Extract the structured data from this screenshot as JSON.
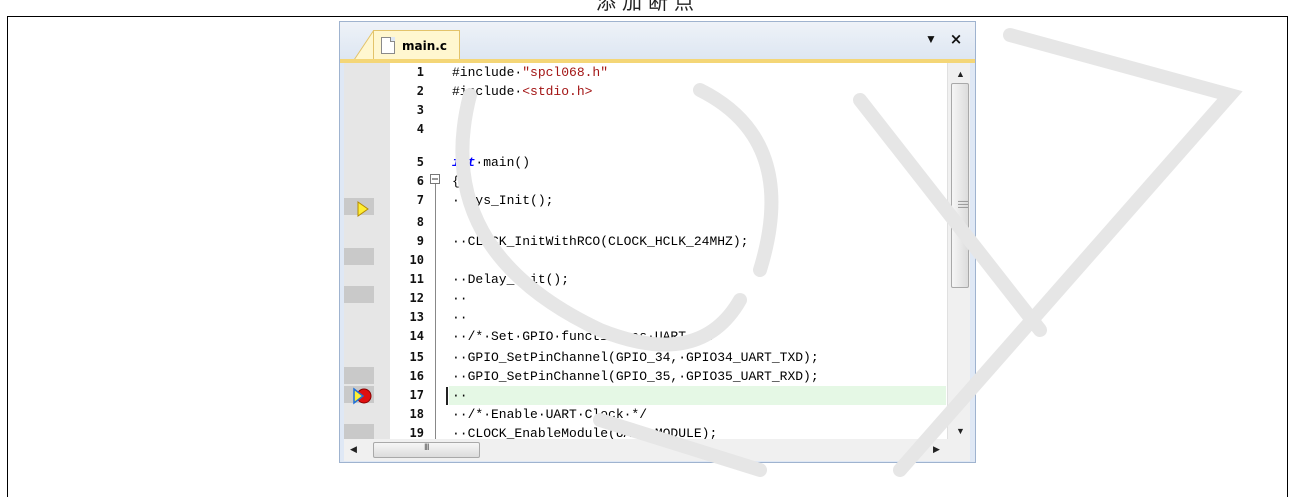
{
  "document": {
    "caption_fragment": "添加断点"
  },
  "editor": {
    "tab_title": "main.c",
    "close_glyph": "×",
    "dropdown_glyph": "▼",
    "hscroll_grip": "III",
    "lines": [
      {
        "num": "1",
        "text": "#include·\"spcl068.h\""
      },
      {
        "num": "2",
        "text": "#include·<stdio.h>"
      },
      {
        "num": "3",
        "text": ""
      },
      {
        "num": "4",
        "text": ""
      },
      {
        "num": "5",
        "text": "int·main()"
      },
      {
        "num": "6",
        "text": "{"
      },
      {
        "num": "7",
        "text": "··Sys_Init();"
      },
      {
        "num": "8",
        "text": ""
      },
      {
        "num": "9",
        "text": "··CLOCK_InitWithRCO(CLOCK_HCLK_24MHZ);"
      },
      {
        "num": "10",
        "text": ""
      },
      {
        "num": "11",
        "text": "··Delay_Init();"
      },
      {
        "num": "12",
        "text": "··"
      },
      {
        "num": "13",
        "text": "··"
      },
      {
        "num": "14",
        "text": "··/*·Set·GPIO·function·as·UART··*/"
      },
      {
        "num": "15",
        "text": "··GPIO_SetPinChannel(GPIO_34,·GPIO34_UART_TXD);"
      },
      {
        "num": "16",
        "text": "··GPIO_SetPinChannel(GPIO_35,·GPIO35_UART_RXD);"
      },
      {
        "num": "17",
        "text": "··"
      },
      {
        "num": "18",
        "text": "··/*·Enable·UART·Clock·*/"
      },
      {
        "num": "19",
        "text": "··CLOCK_EnableModule(UART_MODULE);"
      }
    ],
    "colors": {
      "keyword": "#0000ff",
      "preprocessor": "#7f2b90",
      "comment": "#008000",
      "current_line": "#e5f8e5",
      "tab_active": "#fff7d0"
    }
  }
}
